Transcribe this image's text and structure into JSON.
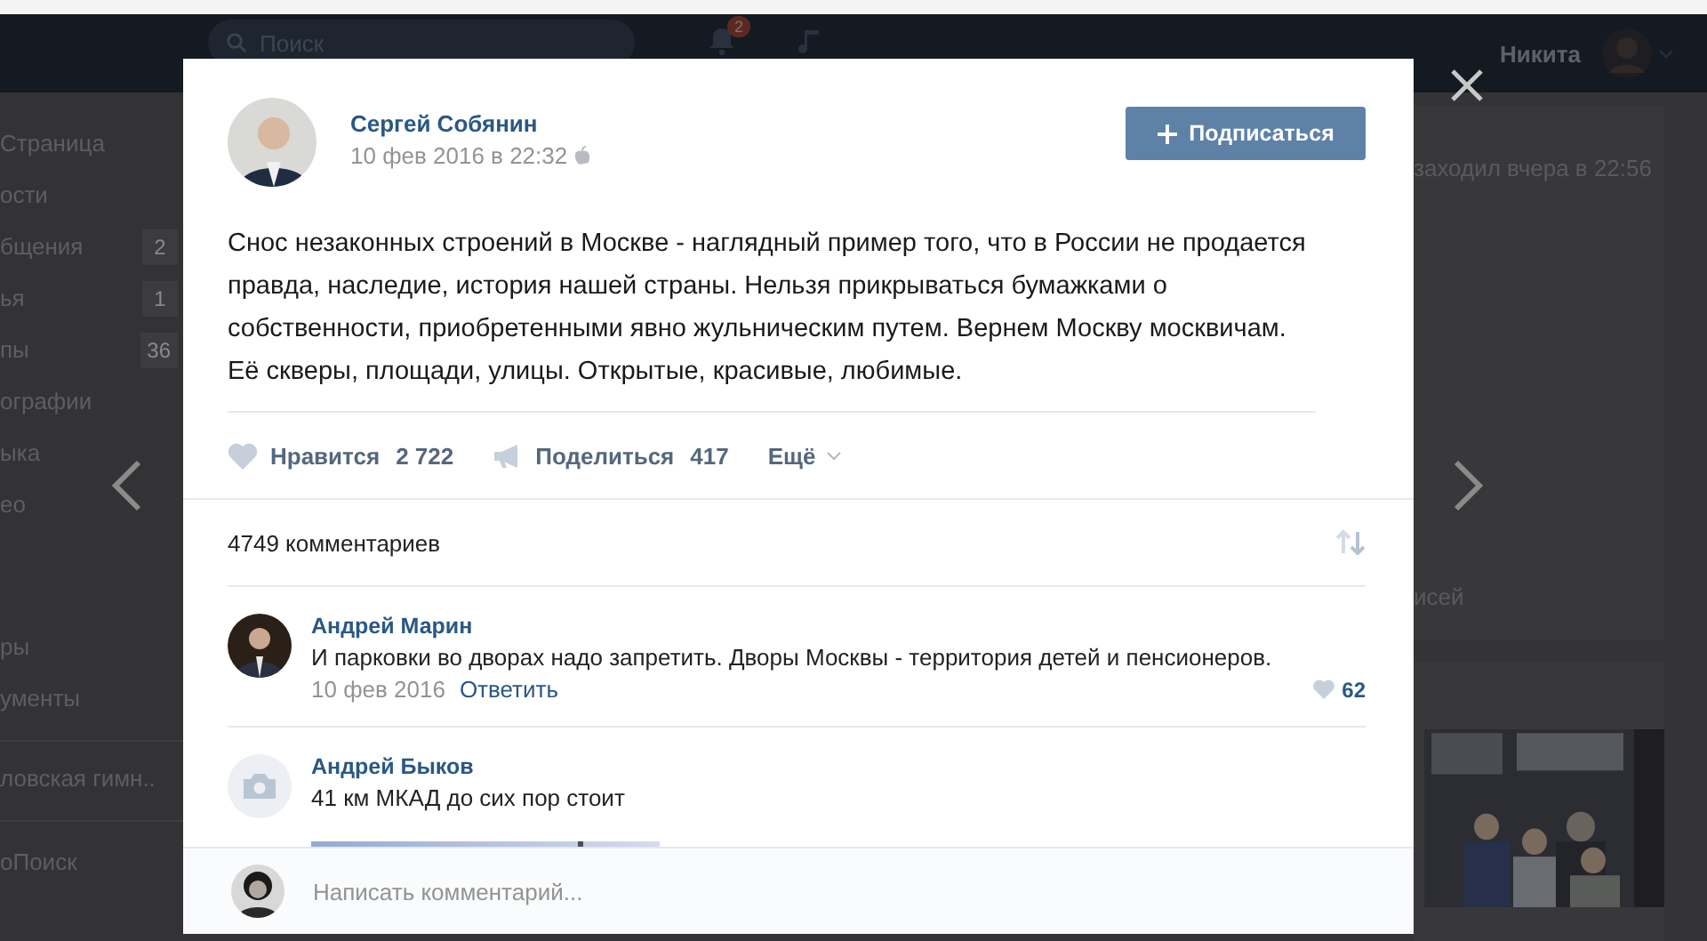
{
  "header": {
    "search": {
      "placeholder": "Поиск"
    },
    "notifications_badge": "2",
    "user_name": "Никита"
  },
  "sidebar": {
    "groups": [
      [
        {
          "label": "Страница"
        },
        {
          "label": "ости"
        },
        {
          "label": "бщения",
          "count": "2"
        },
        {
          "label": "ья",
          "count": "1"
        },
        {
          "label": "пы",
          "count": "36"
        },
        {
          "label": "ографии"
        },
        {
          "label": "ыка"
        },
        {
          "label": "ео"
        }
      ],
      [
        {
          "label": "ры"
        },
        {
          "label": "ументы"
        }
      ],
      [
        {
          "label": "ловская гимн.."
        }
      ],
      [
        {
          "label": "оПоиск"
        }
      ]
    ]
  },
  "profile": {
    "last_seen": "заходил вчера в 22:56",
    "posts_label": "исей"
  },
  "post": {
    "author": "Сергей Собянин",
    "date": "10 фев 2016 в 22:32",
    "subscribe_button": "Подписаться",
    "text": "Снос незаконных строений в Москве - наглядный пример того, что в России не продается правда, наследие, история нашей страны. Нельзя прикрываться бумажками о собственности, приобретенными явно жульническим путем. Вернем Москву москвичам. Её скверы, площади, улицы. Открытые, красивые, любимые.",
    "actions": [
      {
        "kind": "like",
        "label": "Нравится",
        "count": "2 722"
      },
      {
        "kind": "share",
        "label": "Поделиться",
        "count": "417"
      },
      {
        "kind": "more",
        "label": "Ещё"
      }
    ]
  },
  "comments": {
    "count_label": "4749 комментариев",
    "items": [
      {
        "has_photo": true,
        "author": "Андрей Марин",
        "text": "И парковки во дворах надо запретить. Дворы Москвы - территория детей и пенсионеров.",
        "date": "10 фев 2016",
        "reply": "Ответить",
        "likes": "62"
      },
      {
        "has_photo": false,
        "author": "Андрей Быков",
        "text": "41 км МКАД до сих пор стоит"
      }
    ]
  },
  "composer": {
    "placeholder": "Написать комментарий..."
  }
}
